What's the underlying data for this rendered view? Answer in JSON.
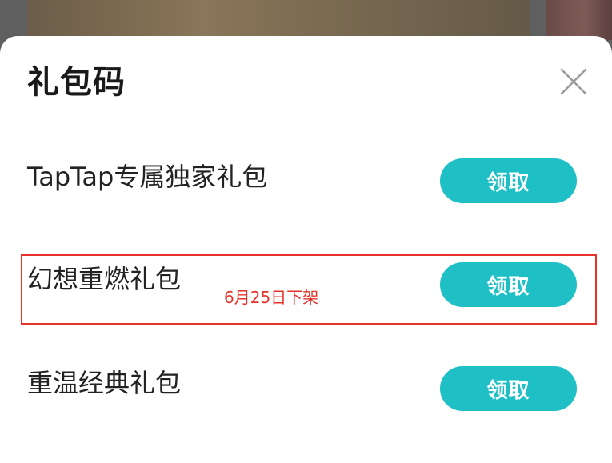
{
  "sheet": {
    "title": "礼包码"
  },
  "gift_packs": [
    {
      "name": "TapTap专属独家礼包",
      "button_label": "领取"
    },
    {
      "name": "幻想重燃礼包",
      "button_label": "领取"
    },
    {
      "name": "重温经典礼包",
      "button_label": "领取"
    }
  ],
  "annotation": {
    "text": "6月25日下架",
    "color": "#e53329"
  },
  "colors": {
    "accent": "#1ec0c6",
    "sheet_background": "#ffffff",
    "overlay": "#6e6e6e"
  },
  "icons": {
    "close": "close-icon"
  }
}
